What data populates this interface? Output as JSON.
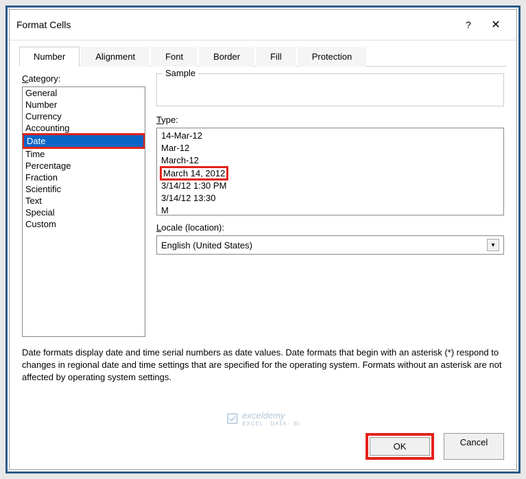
{
  "dialog": {
    "title": "Format Cells",
    "help": "?",
    "close": "✕"
  },
  "tabs": [
    {
      "label": "Number",
      "active": true
    },
    {
      "label": "Alignment",
      "active": false
    },
    {
      "label": "Font",
      "active": false
    },
    {
      "label": "Border",
      "active": false
    },
    {
      "label": "Fill",
      "active": false
    },
    {
      "label": "Protection",
      "active": false
    }
  ],
  "category": {
    "label": "Category:",
    "items": [
      {
        "name": "General",
        "selected": false
      },
      {
        "name": "Number",
        "selected": false
      },
      {
        "name": "Currency",
        "selected": false
      },
      {
        "name": "Accounting",
        "selected": false
      },
      {
        "name": "Date",
        "selected": true,
        "highlighted": true
      },
      {
        "name": "Time",
        "selected": false
      },
      {
        "name": "Percentage",
        "selected": false
      },
      {
        "name": "Fraction",
        "selected": false
      },
      {
        "name": "Scientific",
        "selected": false
      },
      {
        "name": "Text",
        "selected": false
      },
      {
        "name": "Special",
        "selected": false
      },
      {
        "name": "Custom",
        "selected": false
      }
    ]
  },
  "sample": {
    "label": "Sample",
    "value": ""
  },
  "type": {
    "label": "Type:",
    "items": [
      {
        "text": "14-Mar-12"
      },
      {
        "text": "Mar-12"
      },
      {
        "text": "March-12"
      },
      {
        "text": "March 14, 2012",
        "highlighted": true
      },
      {
        "text": "3/14/12 1:30 PM"
      },
      {
        "text": "3/14/12 13:30"
      },
      {
        "text": "M"
      }
    ]
  },
  "locale": {
    "label": "Locale (location):",
    "value": "English (United States)"
  },
  "description": "Date formats display date and time serial numbers as date values.  Date formats that begin with an asterisk (*) respond to changes in regional date and time settings that are specified for the operating system. Formats without an asterisk are not affected by operating system settings.",
  "buttons": {
    "ok": "OK",
    "cancel": "Cancel"
  },
  "watermark": {
    "name": "exceldemy",
    "tagline": "EXCEL · DATA · BI"
  }
}
